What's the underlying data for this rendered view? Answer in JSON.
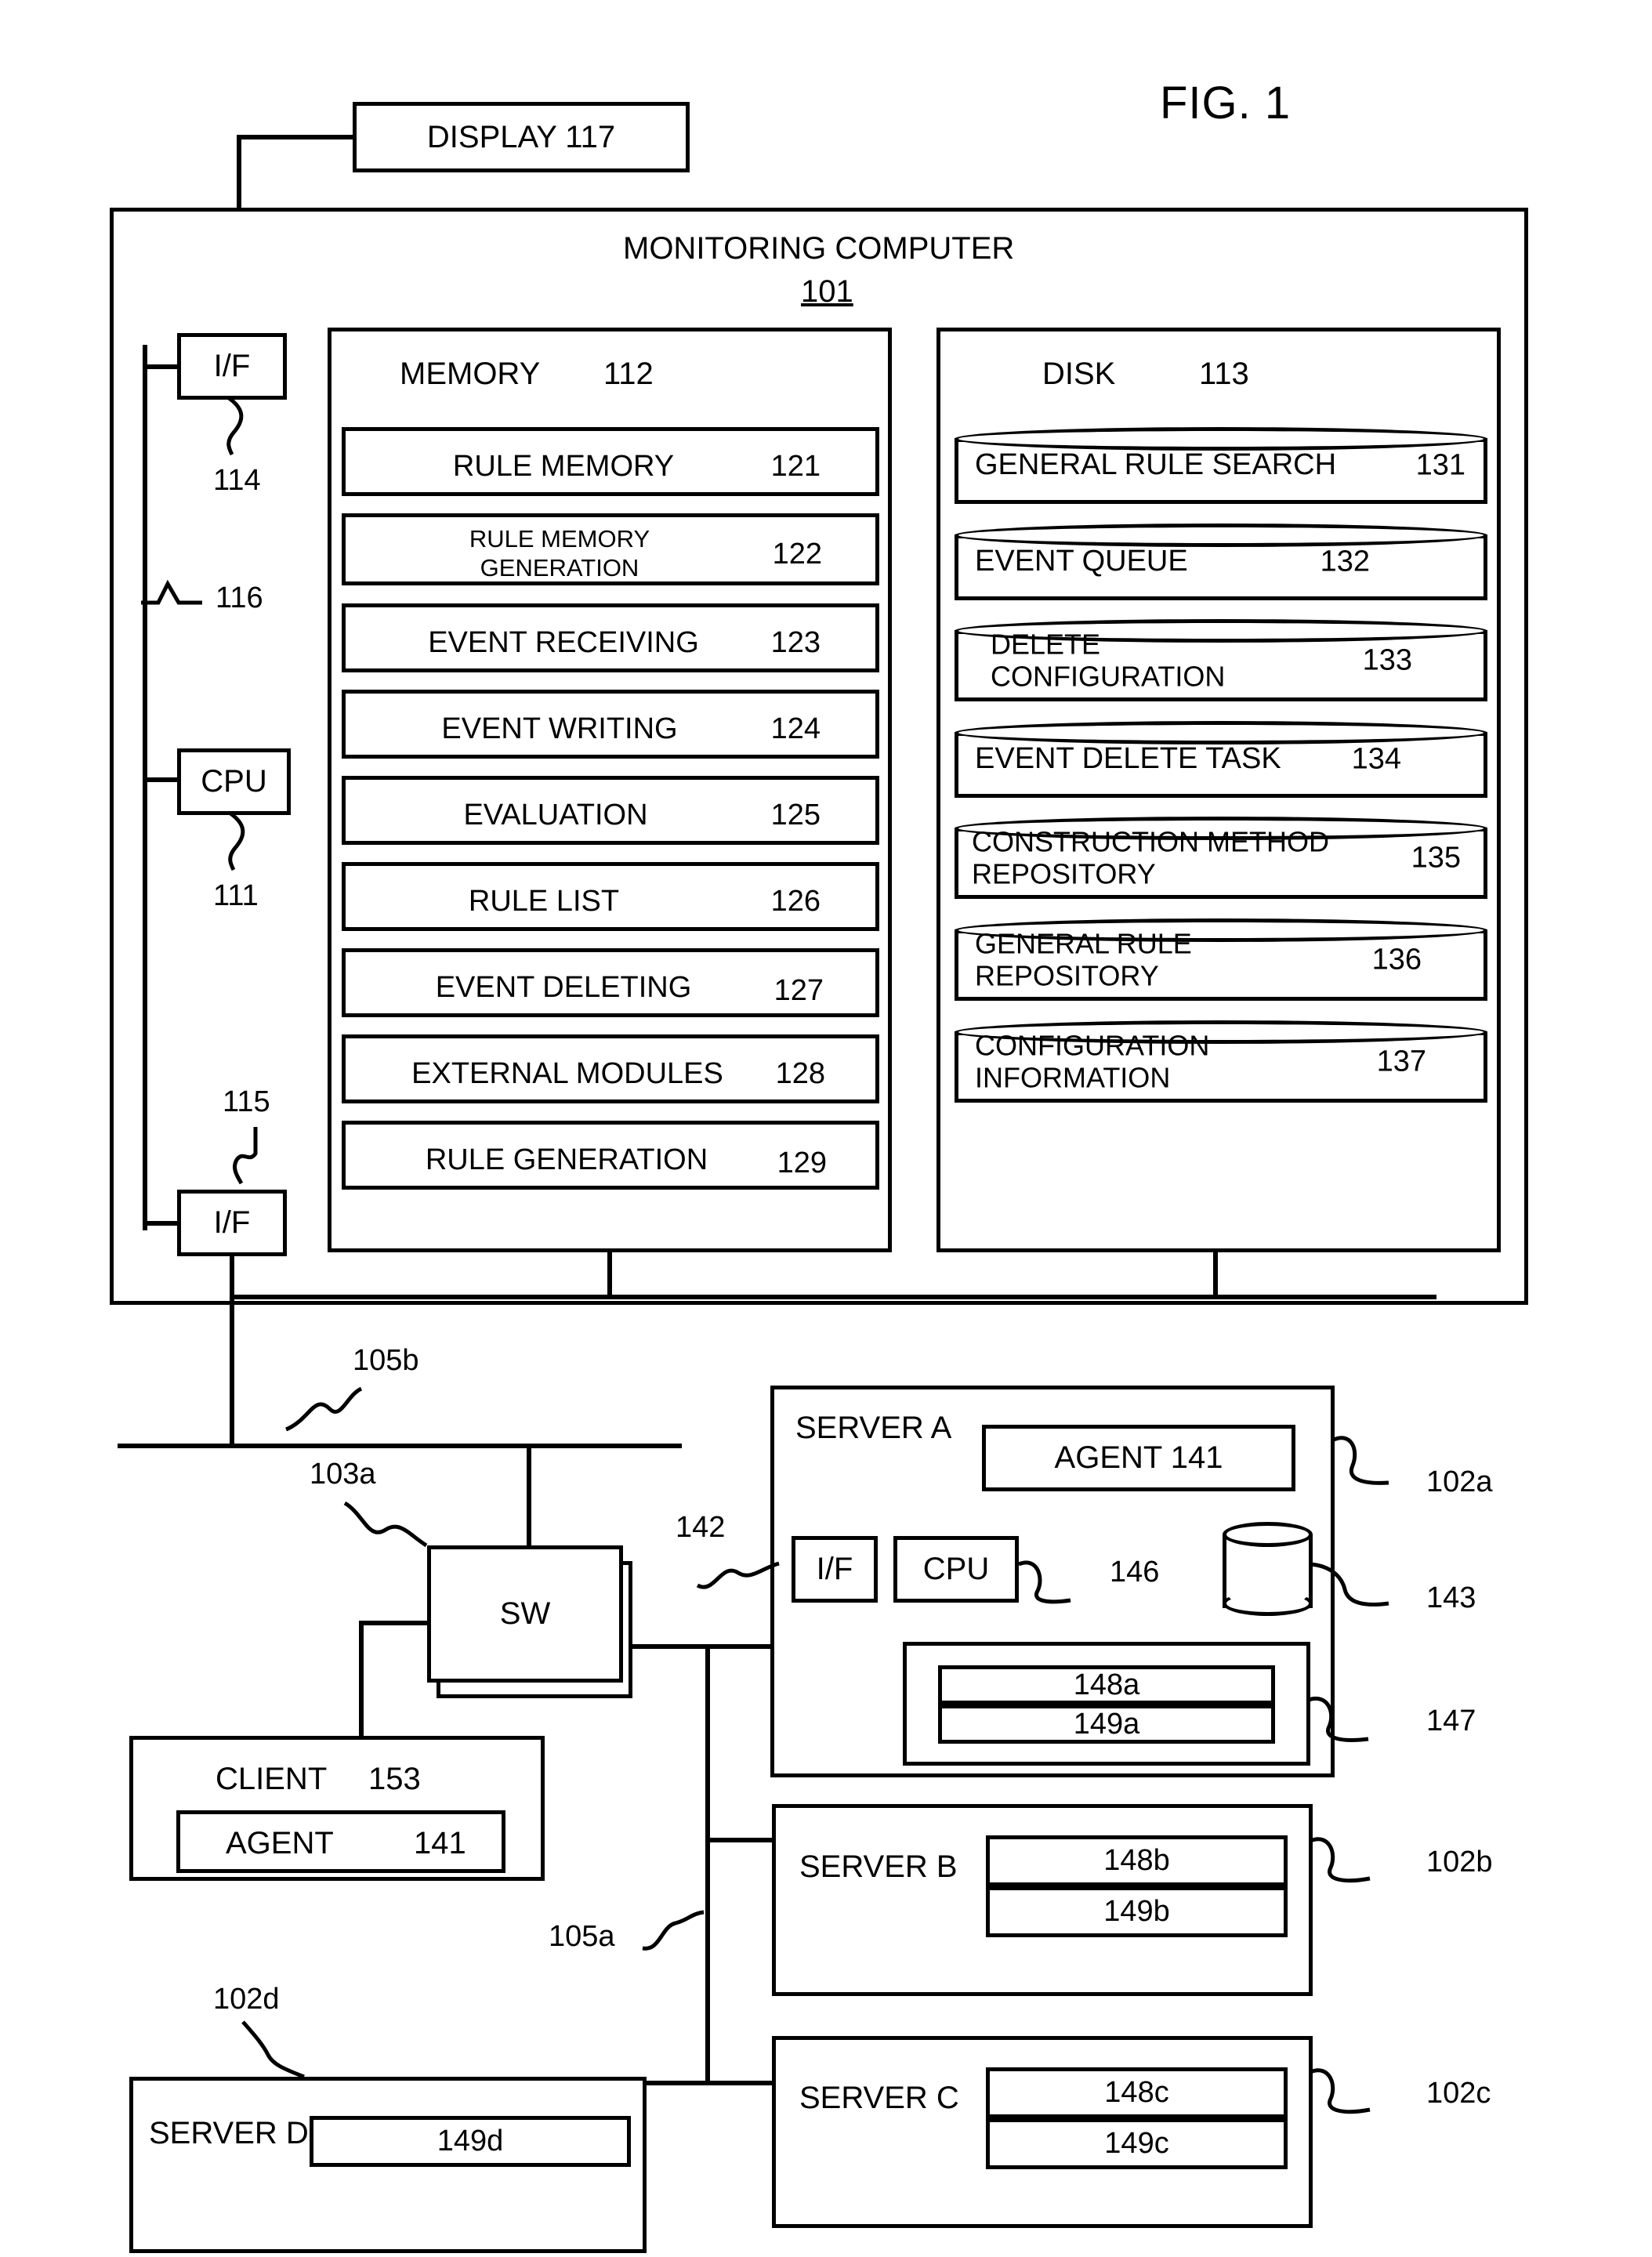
{
  "figure": {
    "title": "FIG. 1"
  },
  "display": {
    "label": "DISPLAY 117"
  },
  "monitoring_computer": {
    "title": "MONITORING COMPUTER",
    "ref": "101",
    "if_top": {
      "label": "I/F",
      "ref": "114"
    },
    "bus_ref": "116",
    "cpu": {
      "label": "CPU",
      "ref": "111"
    },
    "if_bottom": {
      "label": "I/F",
      "ref": "115"
    }
  },
  "memory": {
    "title": "MEMORY",
    "ref": "112",
    "items": [
      {
        "label": "RULE MEMORY",
        "ref": "121",
        "two_line": false
      },
      {
        "label": "RULE MEMORY\nGENERATION",
        "ref": "122",
        "two_line": true
      },
      {
        "label": "EVENT RECEIVING",
        "ref": "123",
        "two_line": false
      },
      {
        "label": "EVENT WRITING",
        "ref": "124",
        "two_line": false
      },
      {
        "label": "EVALUATION",
        "ref": "125",
        "two_line": false
      },
      {
        "label": "RULE LIST",
        "ref": "126",
        "two_line": false
      },
      {
        "label": "EVENT DELETING",
        "ref": "127",
        "two_line": false
      },
      {
        "label": "EXTERNAL MODULES",
        "ref": "128",
        "two_line": false
      },
      {
        "label": "RULE GENERATION",
        "ref": "129",
        "two_line": false
      }
    ]
  },
  "disk": {
    "title": "DISK",
    "ref": "113",
    "items": [
      {
        "label": "GENERAL RULE SEARCH",
        "ref": "131",
        "inline_ref": true
      },
      {
        "label": "EVENT QUEUE",
        "ref": "132",
        "inline_ref": false
      },
      {
        "label": "DELETE\nCONFIGURATION",
        "ref": "133",
        "inline_ref": false
      },
      {
        "label": "EVENT DELETE TASK",
        "ref": "134",
        "inline_ref": false
      },
      {
        "label": "CONSTRUCTION METHOD\nREPOSITORY",
        "ref": "135",
        "inline_ref": false
      },
      {
        "label": "GENERAL RULE\nREPOSITORY",
        "ref": "136",
        "inline_ref": false
      },
      {
        "label": "CONFIGURATION\nINFORMATION",
        "ref": "137",
        "inline_ref": false
      }
    ]
  },
  "network": {
    "upper_bus_ref": "105b",
    "lower_bus_ref": "105a",
    "switch": {
      "label": "SW",
      "ref": "103a"
    }
  },
  "client": {
    "title": "CLIENT",
    "ref": "153",
    "agent": {
      "label": "AGENT",
      "ref": "141"
    }
  },
  "server_a": {
    "title": "SERVER A",
    "ref": "102a",
    "agent_label": "AGENT 141",
    "if_label": "I/F",
    "if_ref": "142",
    "cpu_label": "CPU",
    "cpu_ref": "146",
    "db_ref": "143",
    "group_ref": "147",
    "rows": [
      "148a",
      "149a"
    ]
  },
  "server_b": {
    "title": "SERVER B",
    "ref": "102b",
    "rows": [
      "148b",
      "149b"
    ]
  },
  "server_c": {
    "title": "SERVER C",
    "ref": "102c",
    "rows": [
      "148c",
      "149c"
    ]
  },
  "server_d": {
    "title": "SERVER D",
    "ref": "102d",
    "rows": [
      "149d"
    ]
  },
  "colors": {
    "ink": "#000000",
    "paper": "#ffffff"
  }
}
